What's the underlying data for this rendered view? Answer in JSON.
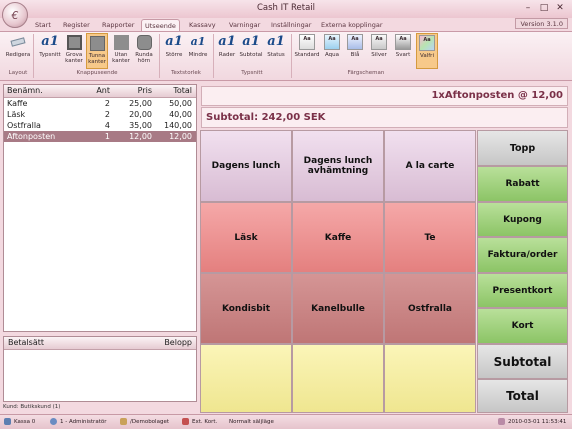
{
  "window": {
    "title": "Cash IT Retail",
    "logo": "€",
    "minimize": "–",
    "maximize": "□",
    "close": "✕"
  },
  "tabs": [
    "Start",
    "Register",
    "Rapporter",
    "Utseende",
    "Kassavy",
    "Varningar",
    "Inställningar",
    "Externa kopplingar"
  ],
  "active_tab": "Utseende",
  "version": "Version 3.1.0",
  "ribbon": {
    "buttons": {
      "redigera": "Redigera",
      "typsnitt": "Typsnitt",
      "grova_kanter": "Grova kanter",
      "tunna_kanter": "Tunna kanter",
      "utan_kanter": "Utan kanter",
      "runda_horn": "Runda hörn",
      "storre": "Större",
      "mindre": "Mindre",
      "rader": "Rader",
      "subtotal": "Subtotal",
      "status": "Status",
      "standard": "Standard",
      "aqua": "Aqua",
      "bla": "Blå",
      "silver": "Silver",
      "svart": "Svart",
      "valfri": "Valfri"
    },
    "groups": {
      "layout": "Layout",
      "knappuseende": "Knappuseende",
      "textstorlek": "Textstorlek",
      "typsnitt": "Typsnitt",
      "fargscheman": "Färgscheman"
    },
    "swatch_text": "Aa"
  },
  "receipt": {
    "headers": {
      "name": "Benämn.",
      "qty": "Ant",
      "price": "Pris",
      "total": "Total"
    },
    "rows": [
      {
        "name": "Kaffe",
        "qty": "2",
        "price": "25,00",
        "total": "50,00"
      },
      {
        "name": "Läsk",
        "qty": "2",
        "price": "20,00",
        "total": "40,00"
      },
      {
        "name": "Ostfralla",
        "qty": "4",
        "price": "35,00",
        "total": "140,00"
      },
      {
        "name": "Aftonposten",
        "qty": "1",
        "price": "12,00",
        "total": "12,00"
      }
    ]
  },
  "payment": {
    "method": "Betalsätt",
    "amount": "Belopp"
  },
  "customer": "Kund: Butikskund (1)",
  "info": "1xAftonposten @ 12,00",
  "subtotal": "Subtotal: 242,00 SEK",
  "product_buttons": [
    "Dagens lunch",
    "Dagens lunch avhämtning",
    "A la carte",
    "Läsk",
    "Kaffe",
    "Te",
    "Kondisbit",
    "Kanelbulle",
    "Ostfralla",
    "",
    "",
    ""
  ],
  "action_buttons": [
    "Topp",
    "Rabatt",
    "Kupong",
    "Faktura/order",
    "Presentkort",
    "Kort",
    "Subtotal",
    "Total"
  ],
  "status": {
    "kassa": "Kassa 0",
    "user": "1 - Administratör",
    "db": "/Demobolaget",
    "ext": "Ext. Kort.",
    "mode": "Normalt säljläge",
    "datetime": "2010-03-01 11:53:41"
  }
}
